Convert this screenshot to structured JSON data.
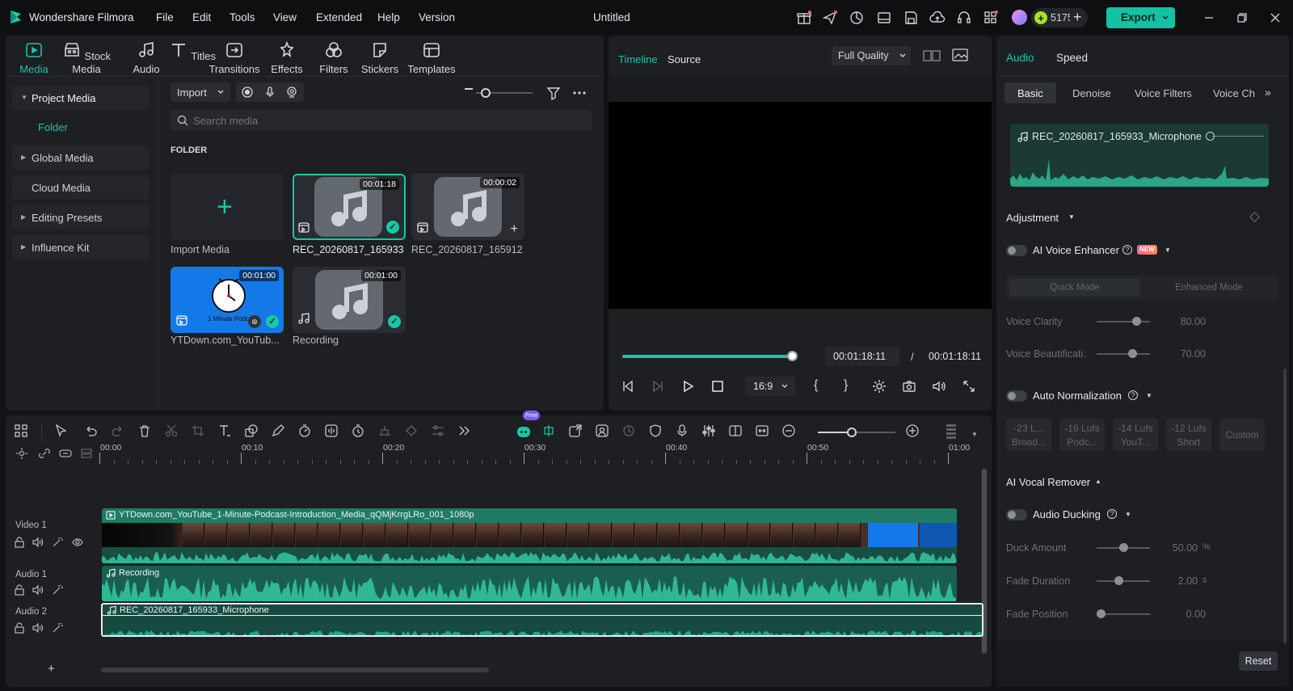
{
  "app": {
    "name": "Wondershare Filmora",
    "doc_title": "Untitled"
  },
  "menu": [
    "File",
    "Edit",
    "Tools",
    "View",
    "Extended",
    "Help",
    "Version"
  ],
  "credits": "5175",
  "export_label": "Export",
  "toolbar_tabs": [
    "Media",
    "Stock Media",
    "Audio",
    "Titles",
    "Transitions",
    "Effects",
    "Filters",
    "Stickers",
    "Templates"
  ],
  "sidebar": {
    "items": [
      "Project Media",
      "Folder",
      "Global Media",
      "Cloud Media",
      "Editing Presets",
      "Influence Kit"
    ]
  },
  "media": {
    "import_label": "Import",
    "search_placeholder": "Search media",
    "folder_heading": "FOLDER",
    "items": [
      {
        "label": "Import Media"
      },
      {
        "label": "REC_20260817_165933",
        "duration": "00:01:18"
      },
      {
        "label": "REC_20260817_165912",
        "duration": "00:00:02"
      },
      {
        "label": "YTDown.com_YouTub...",
        "duration": "00:01:00"
      },
      {
        "label": "Recording",
        "duration": "00:01:00"
      }
    ]
  },
  "preview": {
    "tabs": [
      "Timeline",
      "Source"
    ],
    "quality": "Full Quality",
    "progress": 1.0,
    "current_time": "00:01:18:11",
    "separator": "/",
    "total_time": "00:01:18:11",
    "ratio": "16:9"
  },
  "timeline": {
    "ruler": [
      "00:00",
      "00:10",
      "00:20",
      "00:30",
      "00:40",
      "00:50",
      "01:00"
    ],
    "tracks": [
      {
        "name": "Video 1",
        "clip": "YTDown.com_YouTube_1-Minute-Podcast-Introduction_Media_qQMjKrrgLRo_001_1080p"
      },
      {
        "name": "Audio 1",
        "clip": "Recording"
      },
      {
        "name": "Audio 2",
        "clip": "REC_20260817_165933_Microphone"
      }
    ],
    "free_badge": "Free",
    "add_track": "+"
  },
  "properties": {
    "tabs": [
      "Audio",
      "Speed"
    ],
    "subtabs": [
      "Basic",
      "Denoise",
      "Voice Filters",
      "Voice Ch"
    ],
    "clip_name": "REC_20260817_165933_Microphone",
    "adjustment": "Adjustment",
    "ai_voice_enhancer": "AI Voice Enhancer",
    "new_badge": "NEW",
    "modes": [
      "Quick Mode",
      "Enhanced Mode"
    ],
    "voice_clarity": {
      "label": "Voice Clarity",
      "value": "80.00",
      "level": 0.8
    },
    "voice_beautification": {
      "label": "Voice Beautificati...",
      "value": "70.00",
      "level": 0.7
    },
    "auto_normalization": "Auto Normalization",
    "presets": [
      {
        "l1": "-23 L...",
        "l2": "Broad..."
      },
      {
        "l1": "-16 Lufs",
        "l2": "Podc..."
      },
      {
        "l1": "-14 Lufs",
        "l2": "YouT..."
      },
      {
        "l1": "-12 Lufs",
        "l2": "Short"
      },
      {
        "l1": "Custom",
        "l2": ""
      }
    ],
    "ai_vocal_remover": "AI Vocal Remover",
    "audio_ducking": "Audio Ducking",
    "duck_amount": {
      "label": "Duck Amount",
      "value": "50.00",
      "unit": "%",
      "level": 0.5
    },
    "fade_duration": {
      "label": "Fade Duration",
      "value": "2.00",
      "unit": "s",
      "level": 0.4
    },
    "fade_position": {
      "label": "Fade Position",
      "value": "0.00",
      "unit": "",
      "level": 0.0
    },
    "reset": "Reset"
  }
}
